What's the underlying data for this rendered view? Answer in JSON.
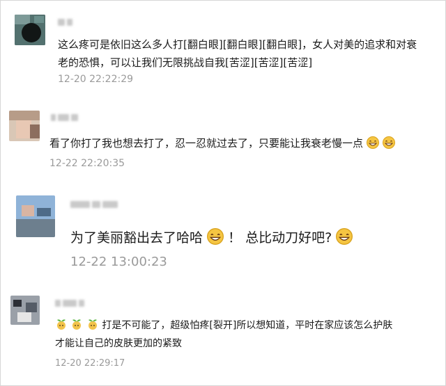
{
  "comments": [
    {
      "line1": "这么疼可是依旧这么多人打[翻白眼][翻白眼][翻白眼]，女人对美的追求和对衰",
      "line2": "老的恐惧，可以让我们无限挑战自我[苦涩][苦涩][苦涩]",
      "time": "12-20 22:22:29"
    },
    {
      "line1": "看了你打了我也想去打了，忍一忍就过去了，只要能让我衰老慢一点",
      "time": "12-22 22:20:35"
    },
    {
      "text_a": "为了美丽豁出去了哈哈",
      "text_b": "！ 总比动刀好吧?",
      "time": "12-22 13:00:23"
    },
    {
      "line1": "打是不可能了，超级怕疼[裂开]所以想知道，平时在家应该怎么护肤",
      "line2": "才能让自己的皮肤更加的紧致",
      "time": "12-20 22:29:17"
    }
  ],
  "icons": {
    "grin": "grinning-face-icon",
    "sprout": "sprout-person-icon"
  }
}
